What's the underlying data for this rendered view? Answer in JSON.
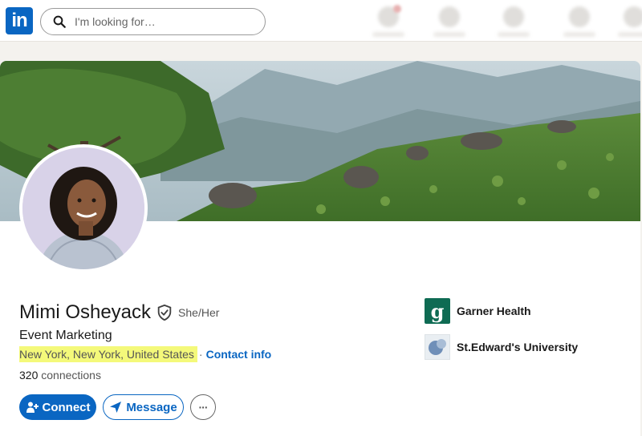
{
  "nav": {
    "logo_text": "in",
    "search_placeholder": "I'm looking for…"
  },
  "profile": {
    "name": "Mimi Osheyack",
    "pronouns": "She/Her",
    "headline": "Event Marketing",
    "location": "New York, New York, United States",
    "separator": "·",
    "contact_info": "Contact info",
    "connections_count": "320",
    "connections_label": " connections"
  },
  "actions": {
    "connect": "Connect",
    "message": "Message",
    "more": "···"
  },
  "experience": [
    {
      "name": "Garner Health",
      "logo_letter": "g"
    },
    {
      "name": "St.Edward's University"
    }
  ],
  "colors": {
    "brand": "#0a66c2",
    "highlight": "#f4f97a",
    "garner": "#0e6b53"
  }
}
